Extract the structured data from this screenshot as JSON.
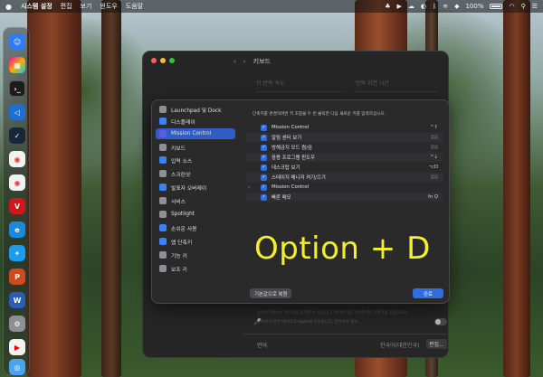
{
  "menubar": {
    "app_name": "시스템 설정",
    "items": [
      "편집",
      "보기",
      "윈도우",
      "도움말"
    ],
    "battery": "100%"
  },
  "window": {
    "title": "키보드",
    "bg_label_repeat": "키 반복 속도",
    "bg_label_delay": "반복 지연 시간",
    "bg_text_line1": "받아쓰기에서는 텍스트를 입력할 수 있습니다. 받아쓰기를 시작하려면 단축키를 사용하거나",
    "bg_text_line2": "받아쓰기 관련 데이터가 Apple에 전송됩니다. 받아쓰기 정보...",
    "bg_language_label": "언어",
    "bg_language_value": "한국어(대한민국)",
    "bg_edit_button": "편집..."
  },
  "sheet": {
    "instruction": "단축키를 변경하려면 키 조합을 두 번 클릭한 다음 새로운 키를 입력하십시오.",
    "sidebar": [
      {
        "label": "Launchpad 및 Dock",
        "color": "#8e8e93",
        "selected": false
      },
      {
        "label": "디스플레이",
        "color": "#3a82f7",
        "selected": false
      },
      {
        "label": "Mission Control",
        "color": "#5b5ce2",
        "selected": true
      },
      {
        "label": "키보드",
        "color": "#8e8e93",
        "selected": false
      },
      {
        "label": "입력 소스",
        "color": "#3a82f7",
        "selected": false
      },
      {
        "label": "스크린샷",
        "color": "#8e8e93",
        "selected": false
      },
      {
        "label": "발표자 오버레이",
        "color": "#3a82f7",
        "selected": false
      },
      {
        "label": "서비스",
        "color": "#8e8e93",
        "selected": false
      },
      {
        "label": "Spotlight",
        "color": "#8e8e93",
        "selected": false
      },
      {
        "label": "손쉬운 사용",
        "color": "#3a82f7",
        "selected": false
      },
      {
        "label": "앱 단축키",
        "color": "#3a82f7",
        "selected": false
      },
      {
        "label": "기능 키",
        "color": "#8e8e93",
        "selected": false
      },
      {
        "label": "보조 키",
        "color": "#8e8e93",
        "selected": false
      }
    ],
    "rows": [
      {
        "label": "Mission Control",
        "key": "^↑",
        "dim": false,
        "expand": false
      },
      {
        "label": "알림 센터 보기",
        "key": "없음",
        "dim": true,
        "expand": false
      },
      {
        "label": "방해금지 모드 켬/끔",
        "key": "없음",
        "dim": true,
        "expand": false
      },
      {
        "label": "응용 프로그램 윈도우",
        "key": "^↓",
        "dim": false,
        "expand": false
      },
      {
        "label": "데스크탑 보기",
        "key": "⌥D",
        "dim": false,
        "expand": false
      },
      {
        "label": "스테이지 매니저 켜기/끄기",
        "key": "없음",
        "dim": true,
        "expand": false
      },
      {
        "label": "Mission Control",
        "key": "",
        "dim": false,
        "expand": true
      },
      {
        "label": "빠른 메모",
        "key": "fn Q",
        "dim": false,
        "expand": false
      }
    ],
    "overlay_text": "Option + D",
    "restore_button": "기본값으로 복원",
    "done_button": "완료"
  }
}
